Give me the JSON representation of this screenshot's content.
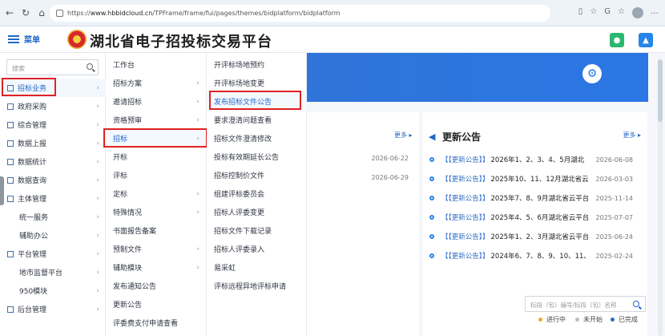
{
  "browser": {
    "url_prefix": "https://",
    "url_domain": "www.hbbidcloud.cn",
    "url_path": "/TPFrame/frame/fui/pages/themes/bidplatform/bidplatform"
  },
  "header": {
    "menu_label": "菜单",
    "site_title": "湖北省电子招投标交易平台"
  },
  "sidebar": {
    "search_placeholder": "搜索",
    "items": [
      {
        "label": "招标业务"
      },
      {
        "label": "政府采购"
      },
      {
        "label": "综合管理"
      },
      {
        "label": "数据上报"
      },
      {
        "label": "数据统计"
      },
      {
        "label": "数据查询"
      },
      {
        "label": "主体管理"
      },
      {
        "label": "统一服务"
      },
      {
        "label": "辅助办公"
      },
      {
        "label": "平台管理"
      },
      {
        "label": "地市监督平台"
      },
      {
        "label": "950模块"
      },
      {
        "label": "后台管理"
      }
    ]
  },
  "menu_level1": [
    {
      "label": "工作台"
    },
    {
      "label": "招标方案"
    },
    {
      "label": "邀请招标"
    },
    {
      "label": "资格预审"
    },
    {
      "label": "招标"
    },
    {
      "label": "开标"
    },
    {
      "label": "评标"
    },
    {
      "label": "定标"
    },
    {
      "label": "特殊情况"
    },
    {
      "label": "书面报告备案"
    },
    {
      "label": "预制文件"
    },
    {
      "label": "辅助模块"
    },
    {
      "label": "发布通知公告"
    },
    {
      "label": "更新公告"
    },
    {
      "label": "评委费支付申请查看"
    }
  ],
  "menu_level2": [
    {
      "label": "开评标场地预约"
    },
    {
      "label": "开评标场地变更"
    },
    {
      "label": "发布招标文件公告"
    },
    {
      "label": "要求澄清问题查看"
    },
    {
      "label": "招标文件澄清修改"
    },
    {
      "label": "投标有效期延长公告"
    },
    {
      "label": "招标控制价文件"
    },
    {
      "label": "组建评标委员会"
    },
    {
      "label": "招标人评委变更"
    },
    {
      "label": "招标文件下载记录"
    },
    {
      "label": "招标人评委录入"
    },
    {
      "label": "易采虹"
    },
    {
      "label": "评标远程异地评标申请"
    }
  ],
  "left_panel": {
    "more_label": "更多 ▸",
    "dates": [
      "2026-06-22",
      "2026-06-29"
    ]
  },
  "updates": {
    "title": "更新公告",
    "more_label": "更多 ▸",
    "rows": [
      {
        "tag": "【【更新公告】】",
        "title": "2026年1、2、3、4、5月湖北",
        "date": "2026-06-08"
      },
      {
        "tag": "【【更新公告】】",
        "title": "2025年10、11、12月湖北省云",
        "date": "2026-03-03"
      },
      {
        "tag": "【【更新公告】】",
        "title": "2025年7、8、9月湖北省云平台",
        "date": "2025-11-14"
      },
      {
        "tag": "【【更新公告】】",
        "title": "2025年4、5、6月湖北省云平台",
        "date": "2025-07-07"
      },
      {
        "tag": "【【更新公告】】",
        "title": "2025年1、2、3月湖北省云平台",
        "date": "2025-06-24"
      },
      {
        "tag": "【【更新公告】】",
        "title": "2024年6、7、8、9、10、11、",
        "date": "2025-02-24"
      }
    ]
  },
  "bottom": {
    "search_placeholder": "标段（包）编号/标段（包）名称",
    "legend": [
      {
        "label": "进行中",
        "color": "#f5a623"
      },
      {
        "label": "未开始",
        "color": "#b8bec6"
      },
      {
        "label": "已完成",
        "color": "#2f6cc4"
      }
    ]
  },
  "colors": {
    "accent": "#2167c7",
    "highlight_border": "#e02222",
    "banner": "#2f74d8"
  }
}
